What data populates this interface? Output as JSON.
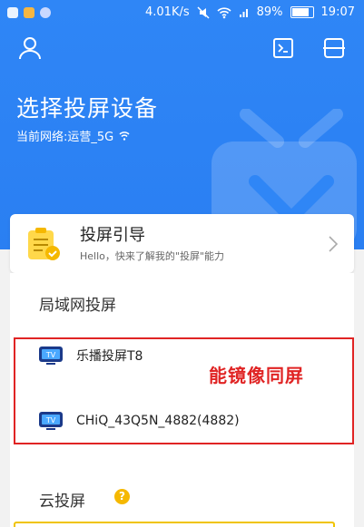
{
  "status_bar": {
    "speed": "4.01K/s",
    "battery": "89%",
    "time": "19:07"
  },
  "header": {
    "title": "选择投屏设备",
    "network_label": "当前网络:运营_5G"
  },
  "guide": {
    "title": "投屏引导",
    "subtitle": "Hello，快来了解我的\"投屏\"能力"
  },
  "lan": {
    "title": "局域网投屏",
    "devices": [
      {
        "name": "乐播投屏T8"
      },
      {
        "name": "CHiQ_43Q5N_4882(4882)"
      }
    ],
    "annotation": "能镜像同屏"
  },
  "cloud": {
    "title": "云投屏",
    "help": "?"
  },
  "colors": {
    "primary": "#2f86f6",
    "annotation_red": "#e02424",
    "accent_yellow": "#f5b800"
  }
}
